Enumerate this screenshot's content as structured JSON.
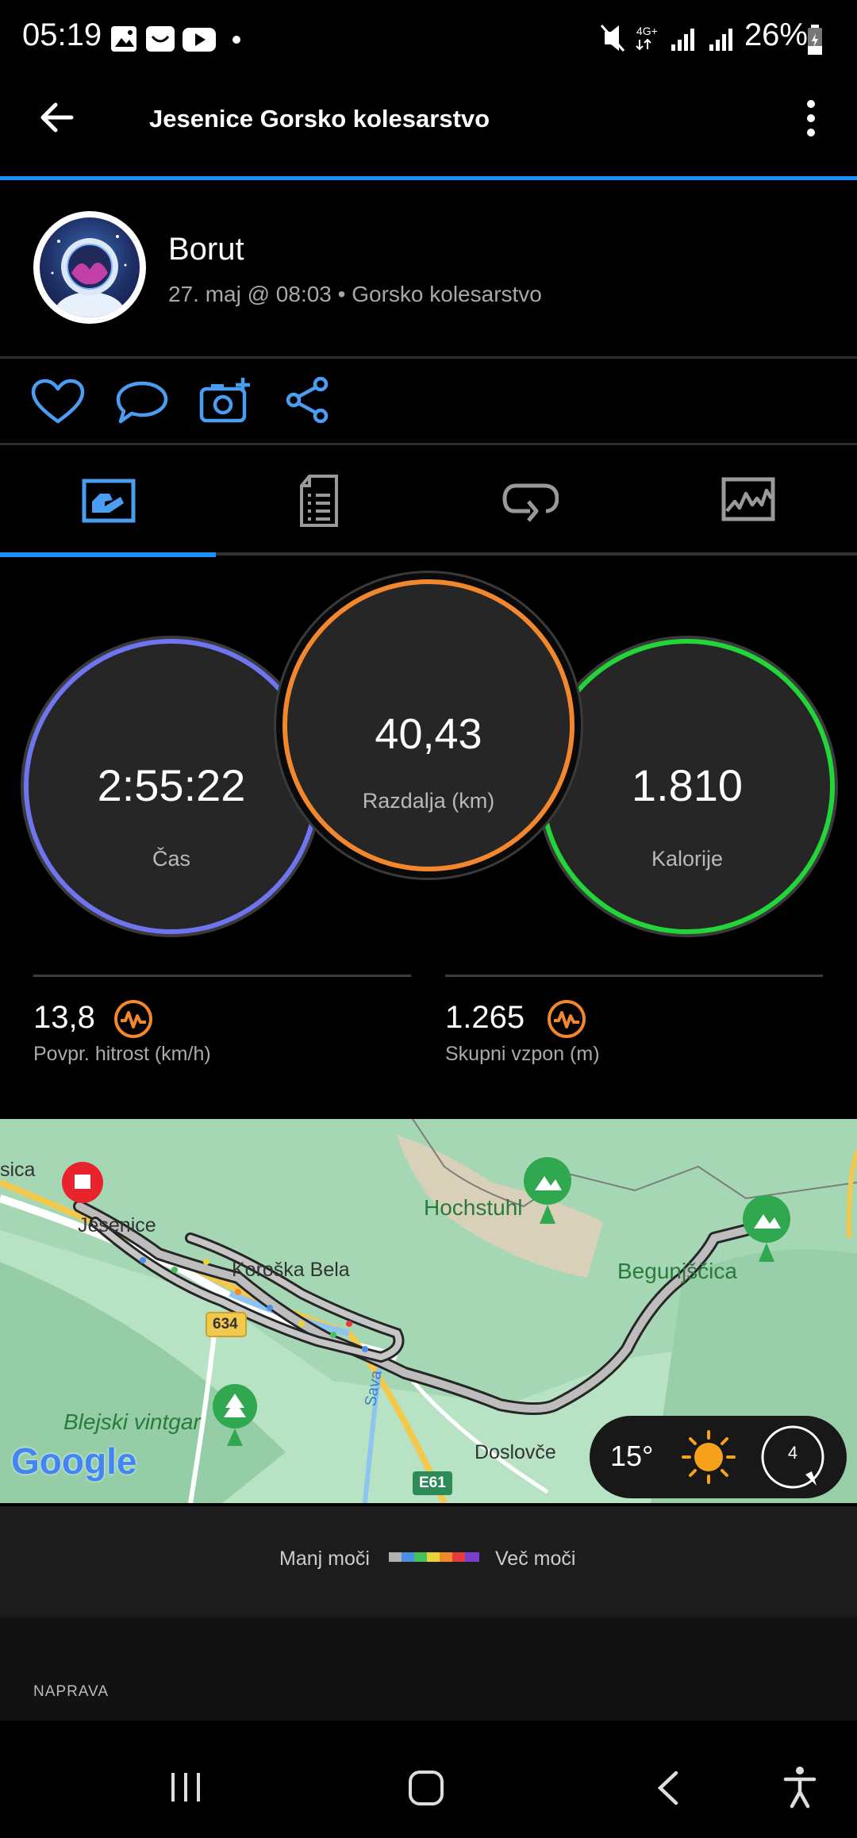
{
  "status_bar": {
    "time": "05:19",
    "network": "4G+",
    "battery": "26%"
  },
  "header": {
    "title": "Jesenice Gorsko kolesarstvo"
  },
  "profile": {
    "name": "Borut",
    "meta": "27. maj @ 08:03 • Gorsko kolesarstvo"
  },
  "metrics": {
    "time": {
      "value": "2:55:22",
      "label": "Čas",
      "color": "#6f74f0"
    },
    "distance": {
      "value": "40,43",
      "label": "Razdalja (km)",
      "color": "#f2872e"
    },
    "calories": {
      "value": "1.810",
      "label": "Kalorije",
      "color": "#22d63a"
    }
  },
  "stats": {
    "avg_speed": {
      "value": "13,8",
      "label": "Povpr. hitrost (km/h)"
    },
    "elevation": {
      "value": "1.265",
      "label": "Skupni vzpon (m)"
    }
  },
  "map": {
    "labels": {
      "jesenice": "Jesenice",
      "koroska_bela": "Koroška Bela",
      "hochstuhl": "Hochstuhl",
      "begunjscica": "Begunjščica",
      "blejski_vintgar": "Blejski vintgar",
      "doslovce": "Doslovče",
      "sica": "sica",
      "sava": "Sava",
      "road_634": "634",
      "road_e61": "E61",
      "google": "Google"
    },
    "weather": {
      "temp": "15°",
      "wind": "4"
    }
  },
  "legend": {
    "low": "Manj moči",
    "high": "Več moči",
    "colors": [
      "#b0b0b0",
      "#4a90e2",
      "#46c05a",
      "#e8d23c",
      "#f08a2c",
      "#e43b3b",
      "#7a3fc8"
    ]
  },
  "device": {
    "label": "NAPRAVA"
  },
  "colors": {
    "accent": "#1e90ff",
    "icon_blue": "#4a9df0",
    "tab_gray": "#9a9a9a",
    "orange_icon": "#f2872e"
  }
}
